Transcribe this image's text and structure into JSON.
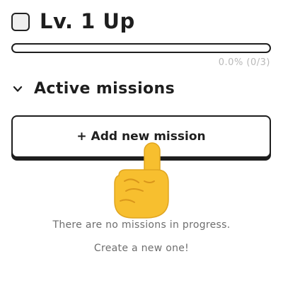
{
  "level": {
    "title": "Lv. 1 Up",
    "checked": false
  },
  "progress": {
    "text": "0.0% (0/3)",
    "percent": 0
  },
  "section": {
    "title": "Active missions",
    "icon": "chevron-down-icon"
  },
  "add_button": {
    "label": "+ Add new mission"
  },
  "pointer": {
    "icon": "pointing-hand-icon"
  },
  "empty_state": {
    "line1": "There are no missions in progress.",
    "line2": "Create a new one!"
  },
  "colors": {
    "ink": "#1e1e1e",
    "hand": "#f7bf2f",
    "muted": "#b9b9b9"
  }
}
